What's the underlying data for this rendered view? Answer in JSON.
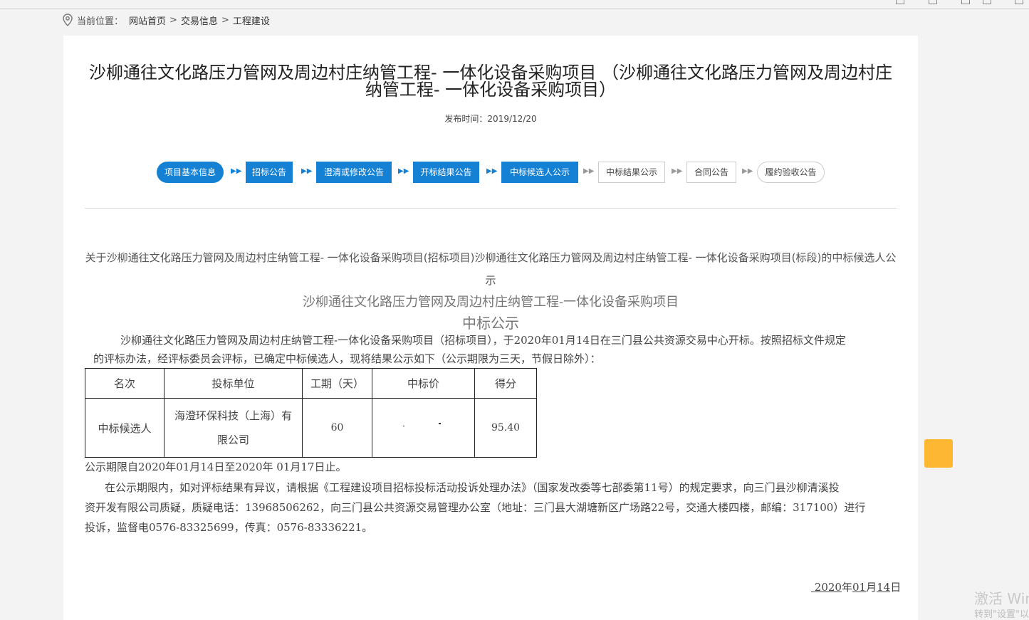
{
  "breadcrumb": {
    "label": "当前位置：",
    "items": [
      "网站首页",
      "交易信息",
      "工程建设"
    ],
    "separator": ">"
  },
  "article": {
    "title": "沙柳通往文化路压力管网及周边村庄纳管工程- 一体化设备采购项目 （沙柳通往文化路压力管网及周边村庄纳管工程- 一体化设备采购项目）",
    "publish_label": "发布时间：",
    "publish_date": "2019/12/20"
  },
  "steps": [
    {
      "label": "项目基本信息",
      "state": "active"
    },
    {
      "label": "招标公告",
      "state": "active"
    },
    {
      "label": "澄清或修改公告",
      "state": "active"
    },
    {
      "label": "开标结果公告",
      "state": "active"
    },
    {
      "label": "中标候选人公示",
      "state": "active"
    },
    {
      "label": "中标结果公示",
      "state": "inactive"
    },
    {
      "label": "合同公告",
      "state": "inactive"
    },
    {
      "label": "履约验收公告",
      "state": "inactive"
    }
  ],
  "notice": {
    "heading": "关于沙柳通往文化路压力管网及周边村庄纳管工程- 一体化设备采购项目(招标项目)沙柳通往文化路压力管网及周边村庄纳管工程- 一体化设备采购项目(标段)的中标候选人公示",
    "subtitle": "沙柳通往文化路压力管网及周边村庄纳管工程-一体化设备采购项目",
    "subtitle2": "中标公示",
    "intro_line1": "沙柳通往文化路压力管网及周边村庄纳管工程-一体化设备采购项目（招标项目），于2020年01月14日在三门县公共资源交易中心开标。按照招标文件规定",
    "intro_line2": "的评标办法，经评标委员会评标，已确定中标候选人，现将结果公示如下（公示期限为三天，节假日除外）：",
    "table": {
      "headers": [
        "名次",
        "投标单位",
        "工期（天）",
        "中标价",
        "得分"
      ],
      "row": {
        "rank": "中标候选人",
        "bidder_line1": "海澄环保科技（上海）有",
        "bidder_line2": "限公司",
        "duration": "60",
        "price": "",
        "score": "95.40"
      }
    },
    "period": "公示期限自2020年01月14日至2020年 01月17日止。",
    "complaint_line1": "在公示期限内，如对评标结果有异议，请根据《工程建设项目招标投标活动投诉处理办法》（国家发改委等七部委第11号）的规定要求，向三门县沙柳清溪投",
    "complaint_line2": "资开发有限公司质疑，质疑电话：13968506262，向三门县公共资源交易管理办公室（地址：三门县大湖塘新区广场路22号，交通大楼四楼，邮编：317100）进行",
    "complaint_line3": "投诉，监督电0576-83325699，传真：0576-83336221。",
    "date": {
      "year": "2020",
      "y_suffix": "年",
      "month": "01",
      "m_suffix": "月",
      "day": "14",
      "d_suffix": "日"
    }
  },
  "watermark": {
    "line1": "激活 Wir",
    "line2": "转到\"设置\"以"
  },
  "colors": {
    "accent": "#1481d4",
    "float_button": "#fdb733"
  }
}
